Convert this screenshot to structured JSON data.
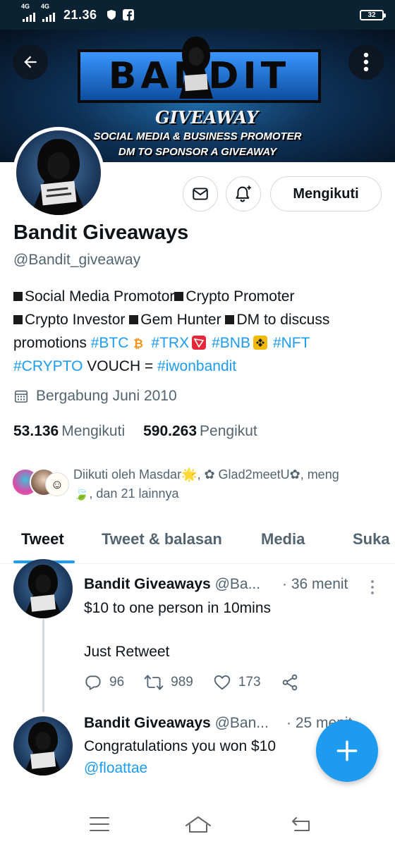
{
  "status_bar": {
    "net1": "4G",
    "net2": "4G",
    "time": "21.36",
    "battery": "32"
  },
  "banner": {
    "title": "BANDIT",
    "subtitle": "GIVEAWAY",
    "line1": "SOCIAL MEDIA & BUSINESS PROMOTER",
    "line2": "DM TO SPONSOR A GIVEAWAY"
  },
  "profile": {
    "follow_label": "Mengikuti",
    "name": "Bandit Giveaways",
    "handle": "@Bandit_giveaway",
    "bio": {
      "l1a": "Social Media Promotor",
      "l1b": "Crypto Promoter",
      "l2a": "Crypto Investor ",
      "l2b": "Gem Hunter ",
      "l2c": "DM to discuss",
      "l3_text": "promotions ",
      "tag_btc": "#BTC",
      "tag_trx": "#TRX",
      "tag_bnb": "#BNB",
      "tag_nft": "#NFT",
      "tag_crypto": "#CRYPTO",
      "vouch": " VOUCH = ",
      "tag_iwon": "#iwonbandit"
    },
    "joined": "Bergabung Juni 2010",
    "following_count": "53.136",
    "following_label": "Mengikuti",
    "followers_count": "590.263",
    "followers_label": "Pengikut",
    "followed_by_line1": "Diikuti oleh Masdar🌟, ✿ Glad2meetU✿, meng",
    "followed_by_line2": "🍃, dan 21 lainnya"
  },
  "tabs": [
    {
      "label": "Tweet"
    },
    {
      "label": "Tweet & balasan"
    },
    {
      "label": "Media"
    },
    {
      "label": "Suka"
    }
  ],
  "tweets": [
    {
      "name": "Bandit Giveaways",
      "handle": "@Ba...",
      "time": "· 36 menit",
      "line1": "$10 to one person in 10mins",
      "line2": "Just Retweet",
      "replies": "96",
      "retweets": "989",
      "likes": "173"
    },
    {
      "name": "Bandit Giveaways",
      "handle": "@Ban...",
      "time": "· 25 menit",
      "line1": "Congratulations you won $10",
      "mention": "@floattae"
    }
  ],
  "colors": {
    "accent": "#1d9bf0",
    "text": "#0f1419",
    "muted": "#536471",
    "status_bar": "#0b2233"
  },
  "icons": [
    "back-arrow-icon",
    "more-vertical-icon",
    "mail-icon",
    "bell-plus-icon",
    "calendar-icon",
    "reply-icon",
    "retweet-icon",
    "like-icon",
    "share-icon",
    "compose-plus-icon",
    "menu-icon",
    "home-icon",
    "back-nav-icon"
  ]
}
